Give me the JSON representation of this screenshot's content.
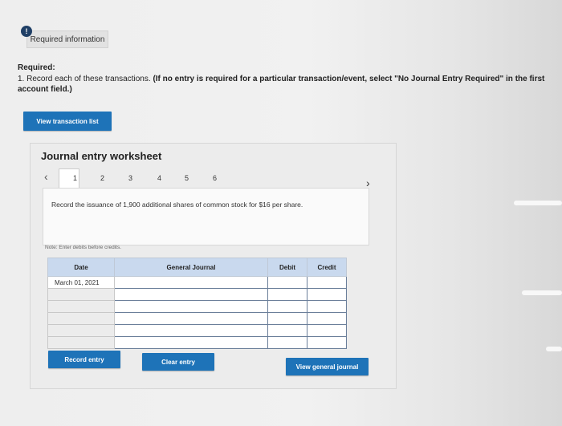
{
  "header": {
    "alert_icon": "!",
    "required_info_tab": "Required information"
  },
  "required": {
    "label": "Required:",
    "instruction_plain": "1. Record each of these transactions. ",
    "instruction_bold": "(If no entry is required for a particular transaction/event, select \"No Journal Entry Required\" in the first account field.)"
  },
  "buttons": {
    "view_transaction_list": "View transaction list",
    "record_entry": "Record entry",
    "clear_entry": "Clear entry",
    "view_general_journal": "View general journal"
  },
  "worksheet": {
    "title": "Journal entry worksheet",
    "tabs": [
      "1",
      "2",
      "3",
      "4",
      "5",
      "6"
    ],
    "active_tab": "1",
    "description": "Record the issuance of 1,900 additional shares of common stock for $16 per share.",
    "note": "Note: Enter debits before credits."
  },
  "table": {
    "headers": {
      "date": "Date",
      "general_journal": "General Journal",
      "debit": "Debit",
      "credit": "Credit"
    },
    "first_date": "March 01, 2021"
  },
  "colors": {
    "accent": "#1e73b8",
    "table_header": "#c9d9ee"
  }
}
